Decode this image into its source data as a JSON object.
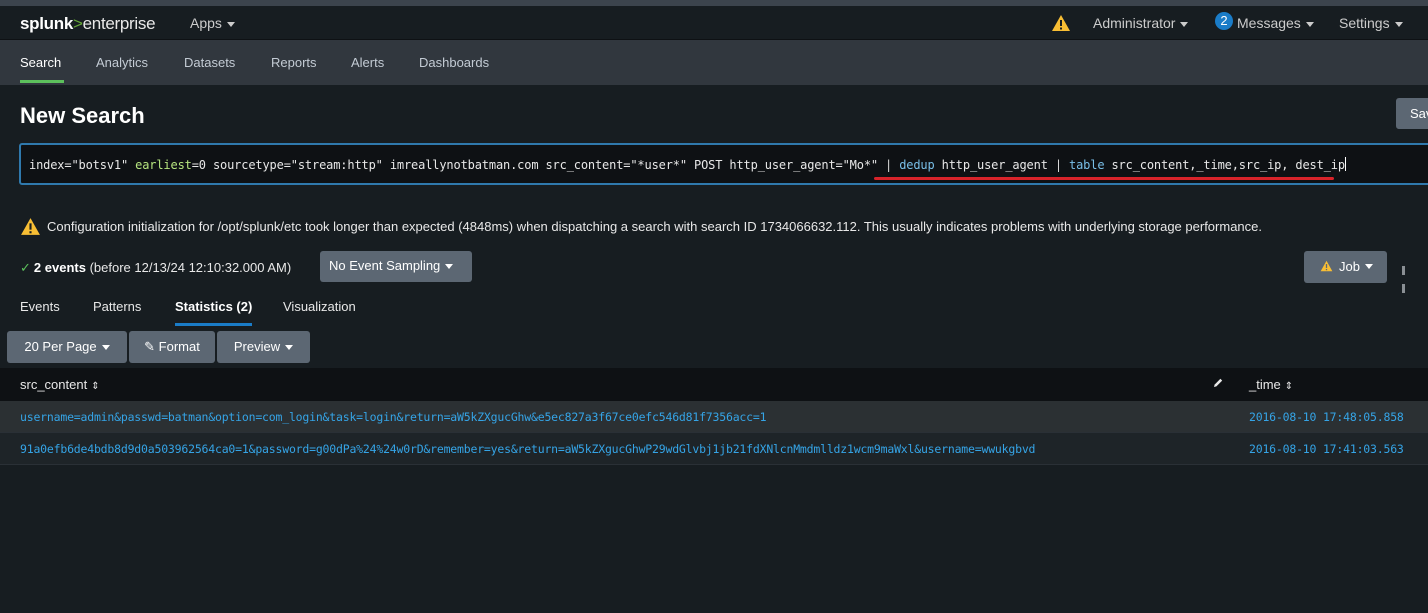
{
  "nav": {
    "logo_part1": "splunk",
    "logo_part2": ">",
    "logo_part3": "enterprise",
    "apps": "Apps",
    "admin": "Administrator",
    "messages_count": "2",
    "messages": "Messages",
    "settings": "Settings"
  },
  "appbar": {
    "tabs": [
      "Search",
      "Analytics",
      "Datasets",
      "Reports",
      "Alerts",
      "Dashboards"
    ],
    "active": "Search"
  },
  "page": {
    "title": "New Search",
    "save_as": "Save As"
  },
  "search": {
    "q1": "index=\"botsv1\" ",
    "q2": "earliest",
    "q3": "=0 sourcetype=\"stream:http\" imreallynotbatman.com src_content=\"*user*\" POST http_user_agent=\"Mo*\" ",
    "q4": "| ",
    "q5": "dedup",
    "q6": " http_user_agent ",
    "q7": "| ",
    "q8": "table",
    "q9": " src_content,_time,src_ip, dest_ip"
  },
  "warning": {
    "text": "Configuration initialization for /opt/splunk/etc took longer than expected (4848ms) when dispatching a search with search ID 1734066632.112. This usually indicates problems with underlying storage performance."
  },
  "status": {
    "events": "2 events",
    "before": " (before 12/13/24 12:10:32.000 AM)",
    "sampling": "No Event Sampling",
    "job": "Job"
  },
  "result_tabs": {
    "events": "Events",
    "patterns": "Patterns",
    "statistics": "Statistics (2)",
    "visualization": "Visualization"
  },
  "toolbar": {
    "per_page": "20 Per Page",
    "format": "Format",
    "preview": "Preview"
  },
  "table": {
    "columns": [
      "src_content",
      "_time"
    ],
    "rows": [
      {
        "src_content": "username=admin&passwd=batman&option=com_login&task=login&return=aW5kZXgucGhw&e5ec827a3f67ce0efc546d81f7356acc=1",
        "time": "2016-08-10 17:48:05.858"
      },
      {
        "src_content": "91a0efb6de4bdb8d9d0a503962564ca0=1&password=g00dPa%24%24w0rD&remember=yes&return=aW5kZXgucGhwP29wdGlvbj1jb21fdXNlcnMmdmlldz1wcm9maWxl&username=wwukgbvd",
        "time": "2016-08-10 17:41:03.563"
      }
    ]
  },
  "colors": {
    "accent_green": "#65a637",
    "search_border": "#2f79ad",
    "link_blue": "#35a4e6",
    "annotation_red": "#d8232a",
    "warning_yellow": "#f8be34"
  }
}
